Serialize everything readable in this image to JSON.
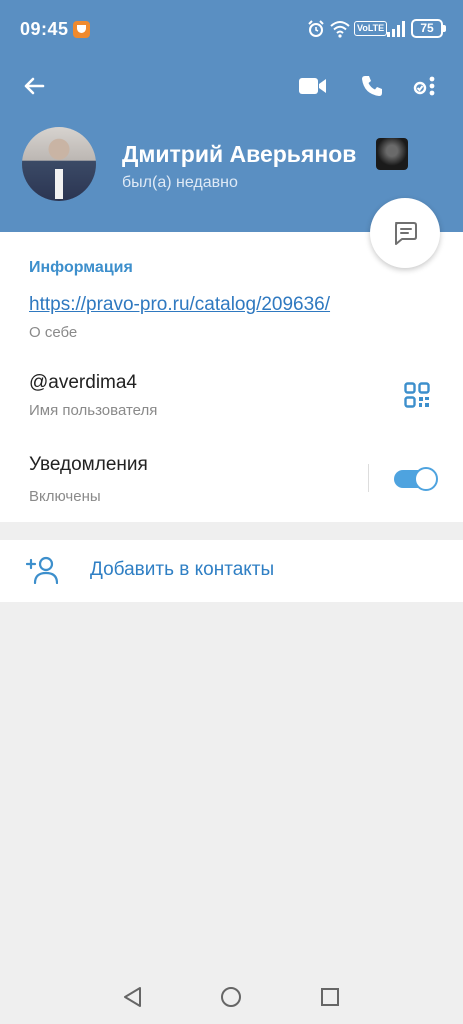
{
  "status_bar": {
    "time": "09:45",
    "network_badge": "VoLTE",
    "battery": "75"
  },
  "profile": {
    "name": "Дмитрий Аверьянов",
    "last_seen": "был(а) недавно"
  },
  "info": {
    "section_title": "Информация",
    "bio_link": "https://pravo-pro.ru/catalog/209636/",
    "bio_caption": "О себе",
    "username": "@averdima4",
    "username_caption": "Имя пользователя",
    "notifications_label": "Уведомления",
    "notifications_state": "Включены",
    "notifications_enabled": true
  },
  "actions": {
    "add_contact": "Добавить в контакты"
  },
  "colors": {
    "header": "#5a8fc2",
    "accent": "#3d8fcc",
    "background": "#efefef"
  }
}
